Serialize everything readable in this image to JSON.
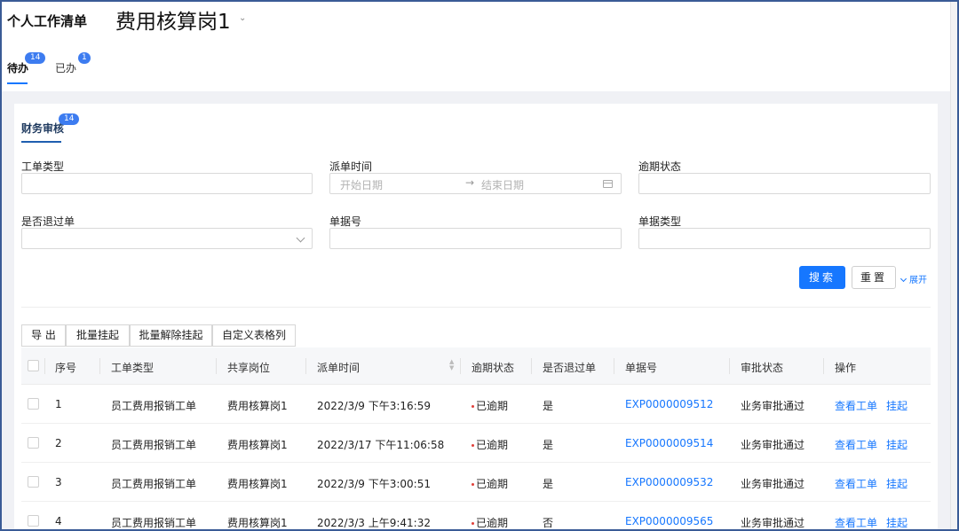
{
  "header": {
    "app_title": "个人工作清单",
    "post_title": "费用核算岗1",
    "tabs": [
      {
        "label": "待办",
        "count": "14"
      },
      {
        "label": "已办",
        "count": "1"
      }
    ]
  },
  "section": {
    "tab_label": "财务审核",
    "count": "14"
  },
  "filters": {
    "ticket_type": "工单类型",
    "dispatch_time": "派单时间",
    "start_placeholder": "开始日期",
    "range_arrow": "→",
    "end_placeholder": "结束日期",
    "overdue_status": "逾期状态",
    "is_returned": "是否退过单",
    "bill_no": "单据号",
    "bill_type": "单据类型"
  },
  "actions": {
    "search": "搜索",
    "reset": "重置",
    "expand": "展开"
  },
  "toolbar": {
    "export": "导 出",
    "batch_suspend": "批量挂起",
    "batch_unsuspend": "批量解除挂起",
    "custom_columns": "自定义表格列"
  },
  "table": {
    "columns": [
      "序号",
      "工单类型",
      "共享岗位",
      "派单时间",
      "逾期状态",
      "是否退过单",
      "单据号",
      "审批状态",
      "操作"
    ],
    "rows": [
      {
        "no": "1",
        "type": "员工费用报销工单",
        "post": "费用核算岗1",
        "time": "2022/3/9 下午3:16:59",
        "overdue": "已逾期",
        "returned": "是",
        "bill": "EXP0000009512",
        "approval": "业务审批通过",
        "view": "查看工单",
        "suspend": "挂起"
      },
      {
        "no": "2",
        "type": "员工费用报销工单",
        "post": "费用核算岗1",
        "time": "2022/3/17 下午11:06:58",
        "overdue": "已逾期",
        "returned": "是",
        "bill": "EXP0000009514",
        "approval": "业务审批通过",
        "view": "查看工单",
        "suspend": "挂起"
      },
      {
        "no": "3",
        "type": "员工费用报销工单",
        "post": "费用核算岗1",
        "time": "2022/3/9 下午3:00:51",
        "overdue": "已逾期",
        "returned": "是",
        "bill": "EXP0000009532",
        "approval": "业务审批通过",
        "view": "查看工单",
        "suspend": "挂起"
      },
      {
        "no": "4",
        "type": "员工费用报销工单",
        "post": "费用核算岗1",
        "time": "2022/3/3 上午9:41:32",
        "overdue": "已逾期",
        "returned": "否",
        "bill": "EXP0000009565",
        "approval": "业务审批通过",
        "view": "查看工单",
        "suspend": "挂起"
      }
    ]
  },
  "colors": {
    "primary": "#1677ff",
    "badge": "#3d7cf0",
    "overdue_dot": "#e0403a"
  }
}
